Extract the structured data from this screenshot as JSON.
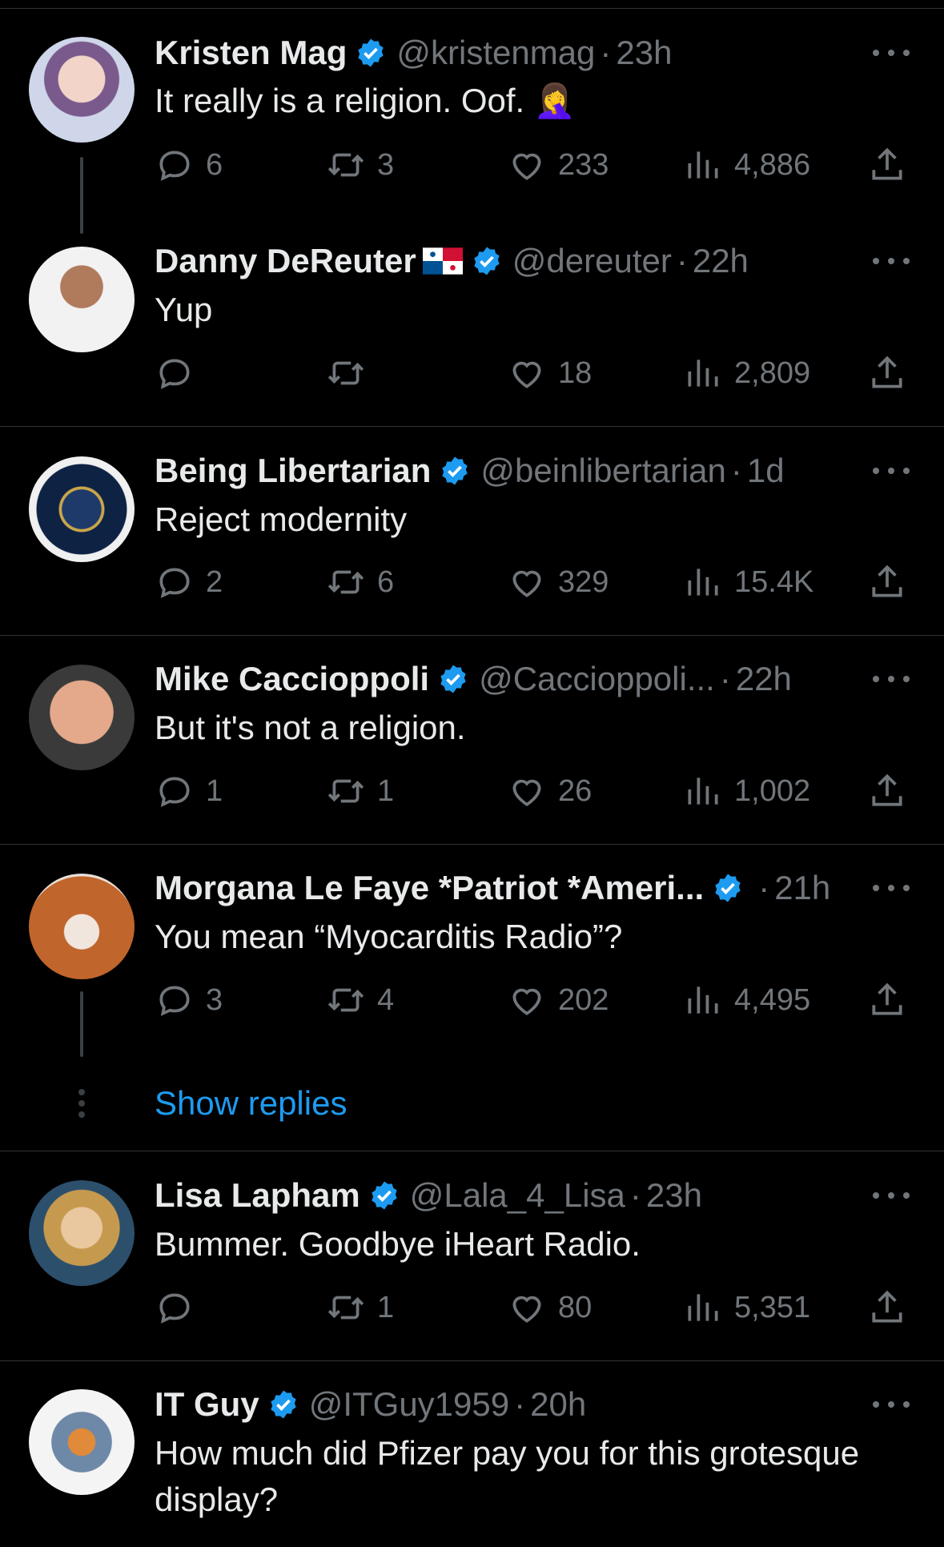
{
  "colors": {
    "background": "#000000",
    "text": "#e7e9ea",
    "muted": "#71767b",
    "accent": "#1d9bf0",
    "divider": "#2f3336"
  },
  "tweets": [
    {
      "name": "Kristen Mag",
      "handle": "@kristenmag",
      "dot": "·",
      "time": "23h",
      "text": "It really is a religion. Oof. 🤦‍♀️",
      "replies": "6",
      "retweets": "3",
      "likes": "233",
      "views": "4,886",
      "verified": true
    },
    {
      "name": "Danny DeReuter",
      "handle": "@dereuter",
      "dot": "·",
      "time": "22h",
      "text": "Yup",
      "replies": "",
      "retweets": "",
      "likes": "18",
      "views": "2,809",
      "verified": true,
      "flag": "panama-flag-icon"
    },
    {
      "name": "Being Libertarian",
      "handle": "@beinlibertarian",
      "dot": "·",
      "time": "1d",
      "text": "Reject modernity",
      "replies": "2",
      "retweets": "6",
      "likes": "329",
      "views": "15.4K",
      "verified": true
    },
    {
      "name": "Mike Caccioppoli",
      "handle": "@Caccioppoli...",
      "dot": "·",
      "time": "22h",
      "text": "But it's not a religion.",
      "replies": "1",
      "retweets": "1",
      "likes": "26",
      "views": "1,002",
      "verified": true
    },
    {
      "name": "Morgana Le Faye *Patriot *Ameri...",
      "handle": "",
      "dot": "·",
      "time": "21h",
      "text": "You mean  “Myocarditis Radio”?",
      "replies": "3",
      "retweets": "4",
      "likes": "202",
      "views": "4,495",
      "verified": true
    },
    {
      "name": "Lisa Lapham",
      "handle": "@Lala_4_Lisa",
      "dot": "·",
      "time": "23h",
      "text": "Bummer. Goodbye iHeart Radio.",
      "replies": "",
      "retweets": "1",
      "likes": "80",
      "views": "5,351",
      "verified": true
    },
    {
      "name": "IT Guy",
      "handle": "@ITGuy1959",
      "dot": "·",
      "time": "20h",
      "text": "How much did Pfizer pay you for this grotesque display?",
      "verified": true
    }
  ],
  "show_replies": "Show replies"
}
